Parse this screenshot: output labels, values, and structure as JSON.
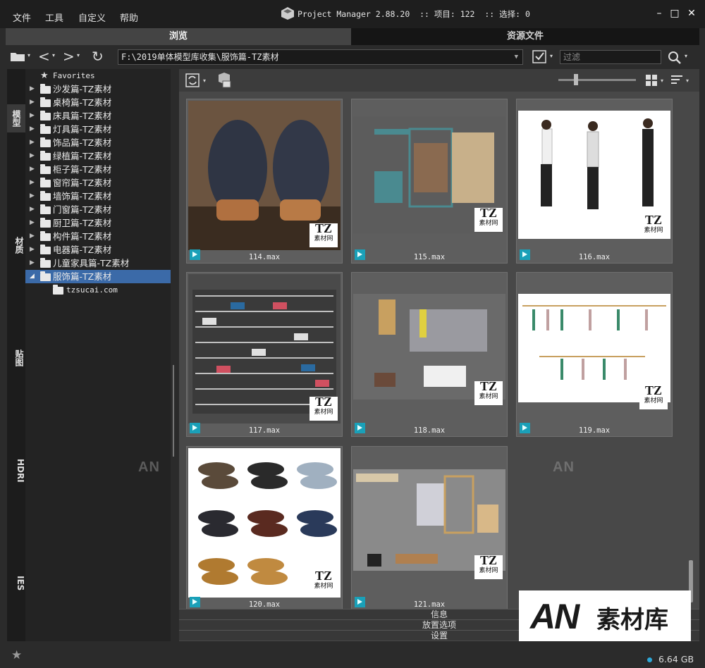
{
  "menu": [
    "文件",
    "工具",
    "自定义",
    "帮助"
  ],
  "title": "Project Manager 2.88.20  :: 项目: 122  :: 选择: 0",
  "tabs": {
    "browse": "浏览",
    "assets": "资源文件"
  },
  "path": "F:\\2019单体模型库收集\\服饰篇-TZ素材",
  "filter_placeholder": "过滤",
  "side_tabs": [
    "模型",
    "材质",
    "贴图",
    "HDRI",
    "IES"
  ],
  "tree": {
    "favorites": "Favorites",
    "items": [
      "沙发篇-TZ素材",
      "桌椅篇-TZ素材",
      "床具篇-TZ素材",
      "灯具篇-TZ素材",
      "饰品篇-TZ素材",
      "绿植篇-TZ素材",
      "柜子篇-TZ素材",
      "窗帘篇-TZ素材",
      "墙饰篇-TZ素材",
      "门窗篇-TZ素材",
      "厨卫篇-TZ素材",
      "构件篇-TZ素材",
      "电器篇-TZ素材",
      "儿童家具篇-TZ素材",
      "服饰篇-TZ素材"
    ],
    "child": "tzsucai.com"
  },
  "thumbs": [
    "114.max",
    "115.max",
    "116.max",
    "117.max",
    "118.max",
    "119.max",
    "120.max",
    "121.max"
  ],
  "tz_badge": {
    "line1": "TZ",
    "line2": "素材网"
  },
  "bottom_panels": [
    "信息",
    "放置选项",
    "设置"
  ],
  "disk": "6.64 GB",
  "watermark": {
    "an": "AN",
    "logo_an": "AN",
    "logo_cn": "素材库"
  },
  "colors": {
    "selection": "#3b6aa8",
    "badge": "#1aa0b8",
    "disk_dot": "#2ea8d8"
  },
  "icons": [
    "folder-icon",
    "back-icon",
    "forward-icon",
    "refresh-icon",
    "checkbox-icon",
    "search-icon",
    "sync-icon",
    "package-icon",
    "grid-view-icon",
    "sort-icon",
    "star-icon"
  ]
}
